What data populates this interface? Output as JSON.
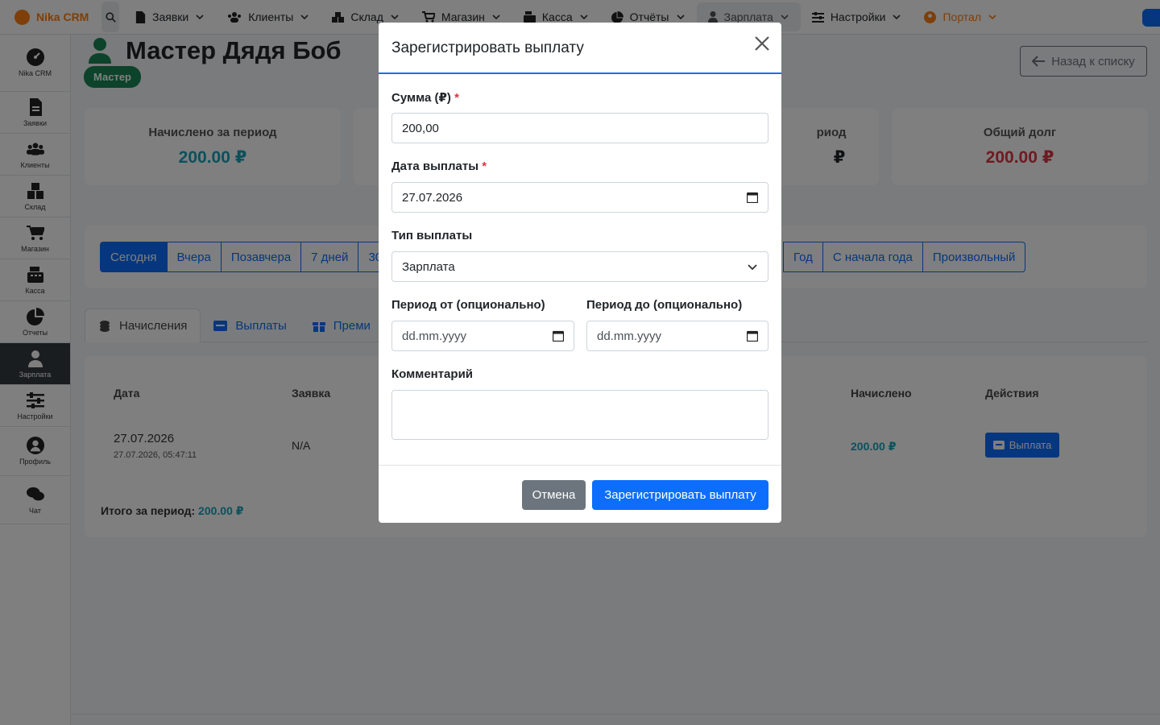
{
  "app": {
    "brand": "Nika CRM"
  },
  "topnav": {
    "items": [
      {
        "label": "Заявки",
        "icon": "file-icon"
      },
      {
        "label": "Клиенты",
        "icon": "users-icon"
      },
      {
        "label": "Склад",
        "icon": "boxes-icon"
      },
      {
        "label": "Магазин",
        "icon": "cart-icon"
      },
      {
        "label": "Касса",
        "icon": "cash-register-icon"
      },
      {
        "label": "Отчёты",
        "icon": "pie-chart-icon"
      },
      {
        "label": "Зарплата",
        "icon": "user-icon",
        "active": true
      },
      {
        "label": "Настройки",
        "icon": "sliders-icon"
      },
      {
        "label": "Портал",
        "icon": "portal-icon"
      }
    ]
  },
  "sidebar": {
    "items": [
      {
        "label": "Nika CRM",
        "icon": "dashboard-icon"
      },
      {
        "label": "Заявки",
        "icon": "file-icon"
      },
      {
        "label": "Клиенты",
        "icon": "users-icon"
      },
      {
        "label": "Склад",
        "icon": "boxes-icon"
      },
      {
        "label": "Магазин",
        "icon": "cart-icon"
      },
      {
        "label": "Касса",
        "icon": "cash-register-icon"
      },
      {
        "label": "Отчеты",
        "icon": "pie-chart-icon"
      },
      {
        "label": "Зарплата",
        "icon": "user-icon",
        "active": true
      },
      {
        "label": "Настройки",
        "icon": "sliders-icon"
      },
      {
        "label": "Профиль",
        "icon": "profile-icon"
      },
      {
        "label": "Чат",
        "icon": "chat-icon"
      }
    ]
  },
  "page": {
    "title": "Мастер Дядя Боб",
    "role": "Мастер",
    "back_label": "Назад к списку"
  },
  "stats": [
    {
      "label": "Начислено за период",
      "value": "200.00 ₽",
      "color": "#17a2b8"
    },
    {
      "label": "риод",
      "value": "₽",
      "color": "#212529"
    },
    {
      "label": "Общий долг",
      "value": "200.00 ₽",
      "color": "#dc3545"
    }
  ],
  "periods_left": [
    "Сегодня",
    "Вчера",
    "Позавчера",
    "7 дней",
    "30"
  ],
  "periods_right": [
    "Год",
    "С начала года",
    "Произвольный"
  ],
  "tabs": [
    {
      "label": "Начисления",
      "icon": "coins-icon",
      "active": true
    },
    {
      "label": "Выплаты",
      "icon": "money-icon"
    },
    {
      "label": "Преми",
      "icon": "gift-icon"
    }
  ],
  "table": {
    "headers": {
      "date": "Дата",
      "order": "Заявка",
      "accrued": "Начислено",
      "actions": "Действия"
    },
    "rows": [
      {
        "date": "27.07.2026",
        "datetime": "27.07.2026, 05:47:11",
        "order": "N/A",
        "accrued": "200.00 ₽",
        "action": "Выплата"
      }
    ],
    "total_label": "Итого за период:",
    "total_value": "200.00 ₽"
  },
  "modal": {
    "title": "Зарегистрировать выплату",
    "amount_label": "Сумма (₽)",
    "amount_value": "200,00",
    "date_label": "Дата выплаты",
    "date_value": "27.07.2026",
    "type_label": "Тип выплаты",
    "type_value": "Зарплата",
    "period_from_label": "Период от (опционально)",
    "period_from_placeholder": "dd.mm.yyyy",
    "period_to_label": "Период до (опционально)",
    "period_to_placeholder": "dd.mm.yyyy",
    "comment_label": "Комментарий",
    "comment_value": "",
    "required_mark": "*",
    "cancel_label": "Отмена",
    "submit_label": "Зарегистрировать выплату"
  },
  "colors": {
    "primary": "#0d6efd",
    "brand": "#fd7e14",
    "success": "#198754",
    "danger": "#dc3545",
    "info": "#17a2b8",
    "secondary": "#6c757d"
  }
}
